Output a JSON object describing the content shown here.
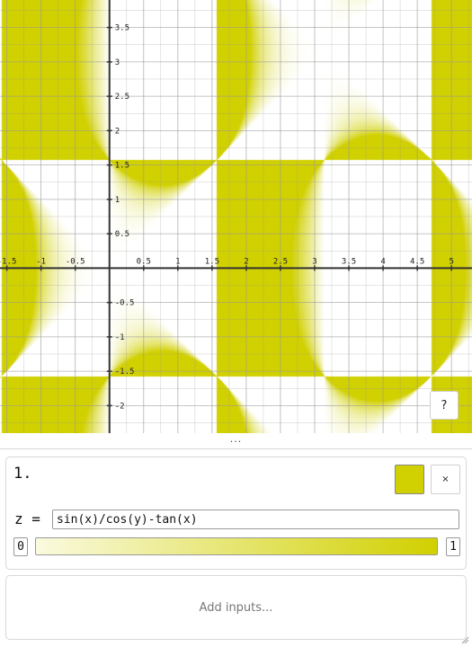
{
  "plot": {
    "fill_color": "#d1d000",
    "expression": "sin(x)/cos(y)-tan(x)",
    "view": {
      "x_min": -1.6,
      "x_max": 5.3,
      "y_min": -2.4,
      "y_max": 3.9
    },
    "x_ticks": [
      {
        "value": -1.5,
        "label": "-1.5"
      },
      {
        "value": -1,
        "label": "-1"
      },
      {
        "value": -0.5,
        "label": "-0.5"
      },
      {
        "value": 0.5,
        "label": "0.5"
      },
      {
        "value": 1,
        "label": "1"
      },
      {
        "value": 1.5,
        "label": "1.5"
      },
      {
        "value": 2,
        "label": "2"
      },
      {
        "value": 2.5,
        "label": "2.5"
      },
      {
        "value": 3,
        "label": "3"
      },
      {
        "value": 3.5,
        "label": "3.5"
      },
      {
        "value": 4,
        "label": "4"
      },
      {
        "value": 4.5,
        "label": "4.5"
      },
      {
        "value": 5,
        "label": "5"
      }
    ],
    "y_ticks": [
      {
        "value": 3.5,
        "label": "3.5"
      },
      {
        "value": 3,
        "label": "3"
      },
      {
        "value": 2.5,
        "label": "2.5"
      },
      {
        "value": 2,
        "label": "2"
      },
      {
        "value": 1.5,
        "label": "1.5"
      },
      {
        "value": 1,
        "label": "1"
      },
      {
        "value": 0.5,
        "label": "0.5"
      },
      {
        "value": -0.5,
        "label": "-0.5"
      },
      {
        "value": -1,
        "label": "-1"
      },
      {
        "value": -1.5,
        "label": "-1.5"
      },
      {
        "value": -2,
        "label": "-2"
      }
    ],
    "help_label": "?"
  },
  "divider": {
    "label": "..."
  },
  "expression_card": {
    "index": "1.",
    "color": "#d1d000",
    "close_label": "×",
    "variable": "z",
    "equals": "=",
    "expression": "sin(x)/cos(y)-tan(x)",
    "range_min": "0",
    "range_max": "1",
    "gradient_start": "#fafadf",
    "gradient_end": "#d1d000"
  },
  "inputs_card": {
    "label": "Add inputs..."
  }
}
